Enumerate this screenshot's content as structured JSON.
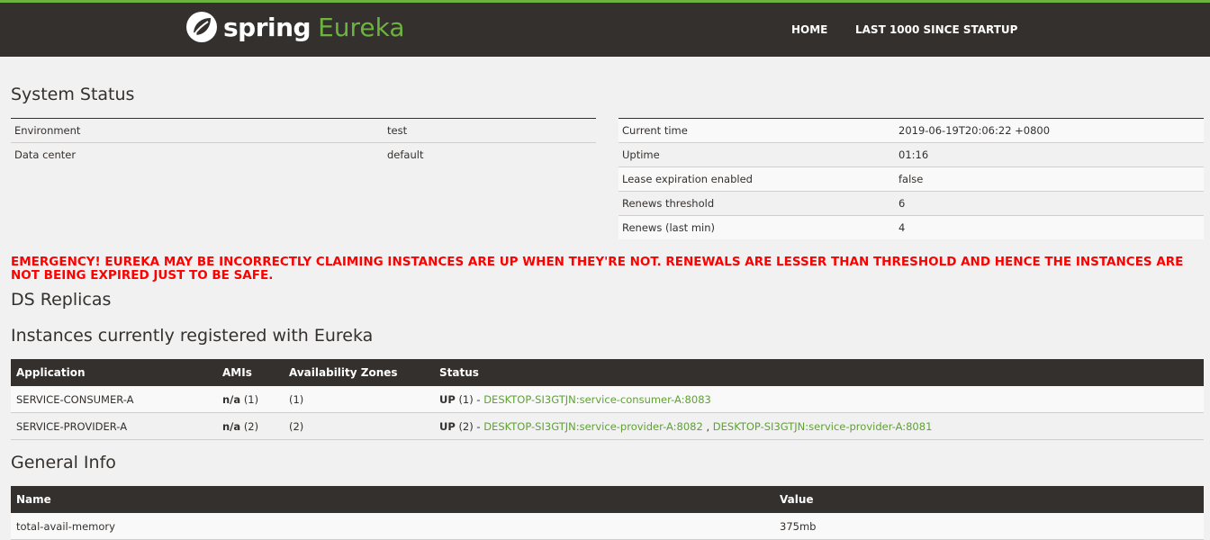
{
  "header": {
    "logo_spring": "spring",
    "logo_eureka": "Eureka",
    "nav": [
      {
        "label": "HOME"
      },
      {
        "label": "LAST 1000 SINCE STARTUP"
      }
    ]
  },
  "system_status": {
    "title": "System Status",
    "left": [
      {
        "key": "Environment",
        "value": "test"
      },
      {
        "key": "Data center",
        "value": "default"
      }
    ],
    "right": [
      {
        "key": "Current time",
        "value": "2019-06-19T20:06:22 +0800"
      },
      {
        "key": "Uptime",
        "value": "01:16"
      },
      {
        "key": "Lease expiration enabled",
        "value": "false"
      },
      {
        "key": "Renews threshold",
        "value": "6"
      },
      {
        "key": "Renews (last min)",
        "value": "4"
      }
    ]
  },
  "emergency": "EMERGENCY! EUREKA MAY BE INCORRECTLY CLAIMING INSTANCES ARE UP WHEN THEY'RE NOT. RENEWALS ARE LESSER THAN THRESHOLD AND HENCE THE INSTANCES ARE NOT BEING EXPIRED JUST TO BE SAFE.",
  "ds_replicas": {
    "title": "DS Replicas"
  },
  "instances": {
    "title": "Instances currently registered with Eureka",
    "headers": [
      "Application",
      "AMIs",
      "Availability Zones",
      "Status"
    ],
    "rows": [
      {
        "application": "SERVICE-CONSUMER-A",
        "ami": "n/a",
        "ami_count": "(1)",
        "zones": "(1)",
        "status": "UP",
        "status_count": "(1) - ",
        "links": [
          "DESKTOP-SI3GTJN:service-consumer-A:8083"
        ],
        "sep": ""
      },
      {
        "application": "SERVICE-PROVIDER-A",
        "ami": "n/a",
        "ami_count": "(2)",
        "zones": "(2)",
        "status": "UP",
        "status_count": "(2) - ",
        "links": [
          "DESKTOP-SI3GTJN:service-provider-A:8082",
          "DESKTOP-SI3GTJN:service-provider-A:8081"
        ],
        "sep": " , "
      }
    ]
  },
  "general_info": {
    "title": "General Info",
    "headers": [
      "Name",
      "Value"
    ],
    "rows": [
      {
        "name": "total-avail-memory",
        "value": "375mb"
      }
    ]
  },
  "colors": {
    "brand_green": "#6db33f",
    "header_bg": "#34302d",
    "emergency": "#ff0000",
    "link": "#5fa134"
  }
}
